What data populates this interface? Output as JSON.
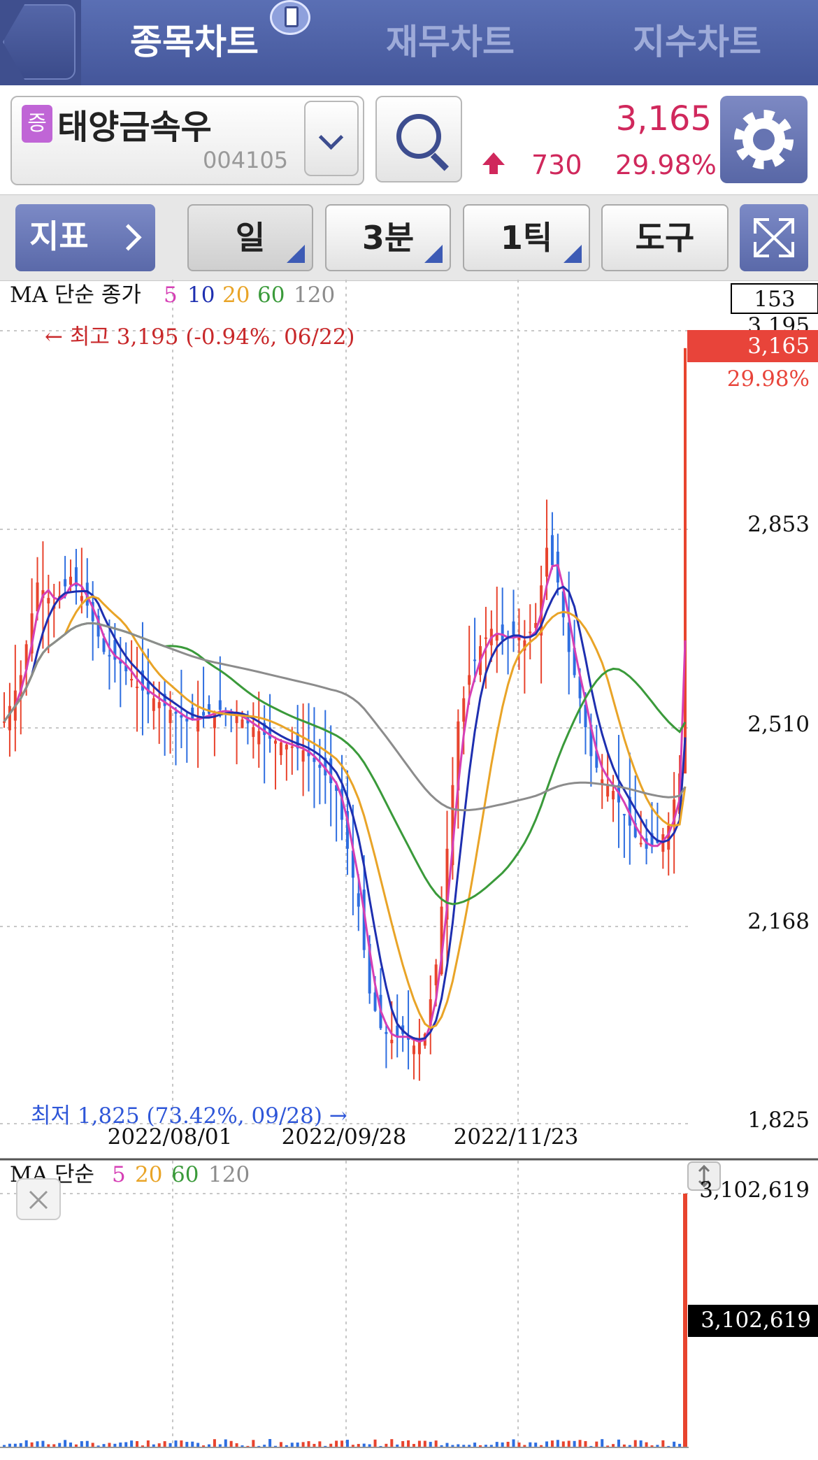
{
  "tabs": [
    "종목차트",
    "재무차트",
    "지수차트"
  ],
  "stock": {
    "badge": "증",
    "name": "태양금속우",
    "code": "004105",
    "price": "3,165",
    "change": "730",
    "change_pct": "29.98%"
  },
  "toolbar": {
    "indicator_label": "지표",
    "period_label": "일",
    "minute_label": "3분",
    "tick_label": "1틱",
    "tools_label": "도구"
  },
  "price_chart": {
    "ma_label": "MA 단순 종가",
    "ma_periods": [
      "5",
      "10",
      "20",
      "60",
      "120"
    ],
    "ma_colors": [
      "#d63fb5",
      "#1e2fb0",
      "#e9a427",
      "#3a9a3a",
      "#8c8c8c"
    ],
    "count_box": "153",
    "top_axis": "3,195",
    "current_price_tag": "3,165",
    "current_pct_tag": "29.98%",
    "y_ticks": [
      "2,853",
      "2,510",
      "2,168",
      "1,825"
    ],
    "x_ticks": [
      "2022/08/01",
      "2022/09/28",
      "2022/11/23"
    ],
    "high_note": "← 최고 3,195 (-0.94%, 06/22)",
    "low_note": "최저 1,825 (73.42%, 09/28) →",
    "up_color": "#e8442e",
    "down_color": "#2e6ee0"
  },
  "volume_chart": {
    "ma_label": "MA 단순",
    "ma_periods": [
      "5",
      "20",
      "60",
      "120"
    ],
    "top_value": "3,102,619",
    "current_tag": "3,102,619"
  }
}
